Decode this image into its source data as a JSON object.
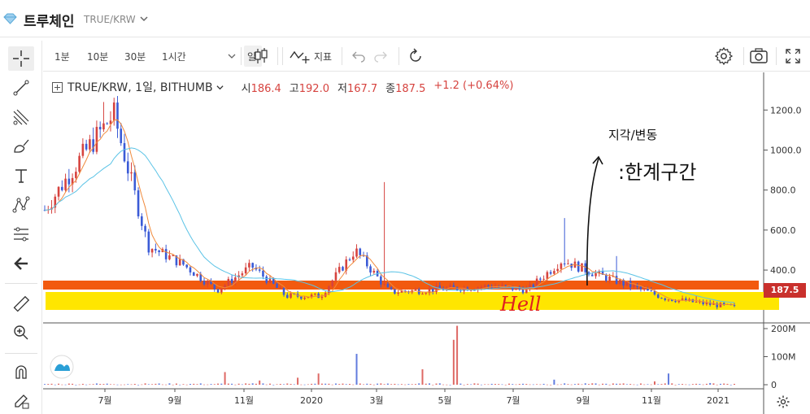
{
  "header": {
    "coin_name": "트루체인",
    "pair": "TRUE/KRW"
  },
  "toolbar": {
    "intervals": [
      "1분",
      "10분",
      "30분",
      "1시간",
      "일"
    ],
    "active_interval": "일",
    "indicator_label": "지표"
  },
  "legend": {
    "symbol": "TRUE/KRW, 1일, BITHUMB",
    "open_label": "시",
    "open": "186.4",
    "high_label": "고",
    "high": "192.0",
    "low_label": "저",
    "low": "167.7",
    "close_label": "종",
    "close": "187.5",
    "change": "+1.2 (+0.64%)"
  },
  "price_axis": {
    "ticks": [
      "1200.0",
      "1000.0",
      "800.0",
      "600.0",
      "400.0"
    ],
    "last_price": "187.5"
  },
  "volume_axis": {
    "ticks": [
      "200M",
      "100M",
      "0"
    ]
  },
  "time_axis": {
    "ticks": [
      "7월",
      "9월",
      "11월",
      "2020",
      "3월",
      "5월",
      "7월",
      "9월",
      "11월",
      "2021"
    ]
  },
  "annotations": {
    "top_note": "지각/변동",
    "main_note": ":한계구간",
    "hell_label": "Hell"
  },
  "colors": {
    "up": "#d6433f",
    "down": "#3b5bd6",
    "ma_short": "#f08a3c",
    "ma_long": "#5bc3e6",
    "orange_band": "#f25a0f",
    "yellow_band": "#ffe600",
    "price_tag": "#c9302c"
  },
  "chart_data": {
    "type": "line",
    "title": "",
    "xlabel": "",
    "ylabel": "",
    "x": [
      "2019-05",
      "2019-06",
      "2019-07",
      "2019-08",
      "2019-09",
      "2019-10",
      "2019-11",
      "2019-12",
      "2020-01",
      "2020-02",
      "2020-03",
      "2020-04",
      "2020-05",
      "2020-06",
      "2020-07",
      "2020-08",
      "2020-09",
      "2020-10",
      "2020-11",
      "2020-12",
      "2021-01"
    ],
    "series": [
      {
        "values": [
          700,
          950,
          1180,
          520,
          430,
          300,
          420,
          270,
          270,
          500,
          290,
          300,
          310,
          320,
          300,
          450,
          380,
          320,
          260,
          235,
          215
        ]
      }
    ],
    "ylim": [
      140,
      1380
    ]
  }
}
